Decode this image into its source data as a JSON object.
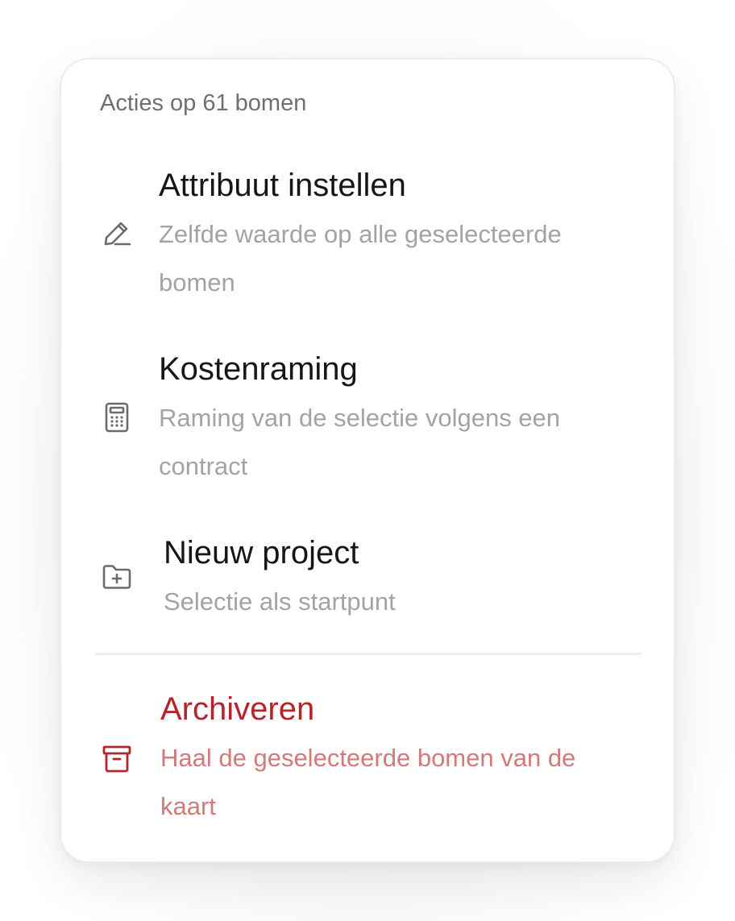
{
  "menu": {
    "header": "Acties op 61 bomen",
    "items": [
      {
        "icon": "pencil-icon",
        "title": "Attribuut instellen",
        "description": "Zelfde waarde op alle geselecteerde bomen"
      },
      {
        "icon": "calculator-icon",
        "title": "Kostenraming",
        "description": "Raming van de selectie volgens een contract"
      },
      {
        "icon": "folder-plus-icon",
        "title": "Nieuw project",
        "description": "Selectie als startpunt"
      },
      {
        "icon": "archive-icon",
        "title": "Archiveren",
        "description": "Haal de geselecteerde bomen van de kaart"
      }
    ]
  },
  "colors": {
    "text": "#161616",
    "muted": "#a3a3a3",
    "header": "#6f6f6f",
    "danger": "#b5242a",
    "danger_muted": "#d27a7a",
    "icon": "#6b6b6b"
  }
}
